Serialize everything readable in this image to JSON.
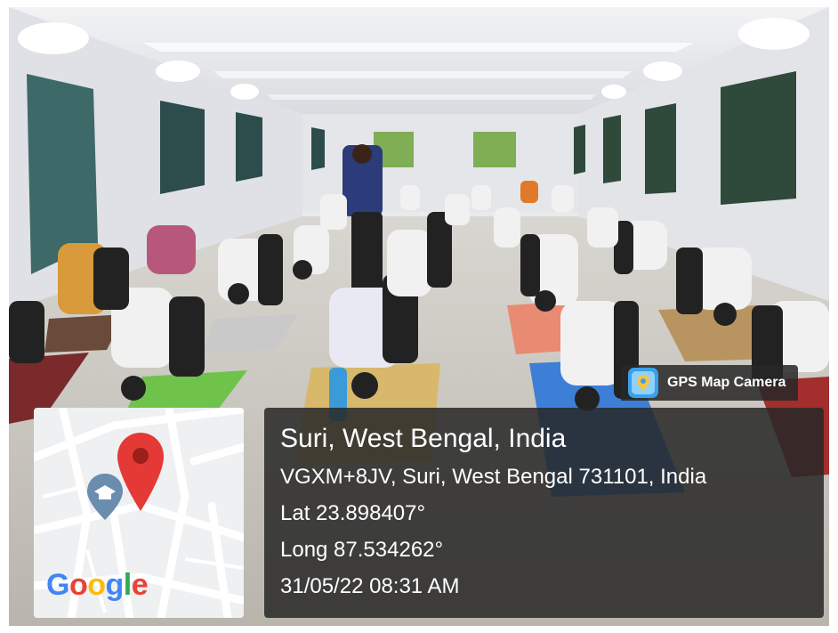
{
  "photo": {
    "scene": "yoga session in hall"
  },
  "overlay": {
    "app_name": "GPS Map Camera",
    "app_icon": "gps-map-camera-icon",
    "location_title": "Suri, West Bengal, India",
    "address": "VGXM+8JV, Suri, West Bengal 731101, India",
    "latitude": "Lat 23.898407°",
    "longitude": "Long 87.534262°",
    "datetime": "31/05/22 08:31 AM",
    "map": {
      "logo_text": "Google",
      "pin_icon": "location-pin-icon",
      "poi_icon": "school-pin-icon"
    },
    "colors": {
      "panel": "#282828",
      "pin": "#e53935",
      "poi": "#6a8caf"
    }
  }
}
